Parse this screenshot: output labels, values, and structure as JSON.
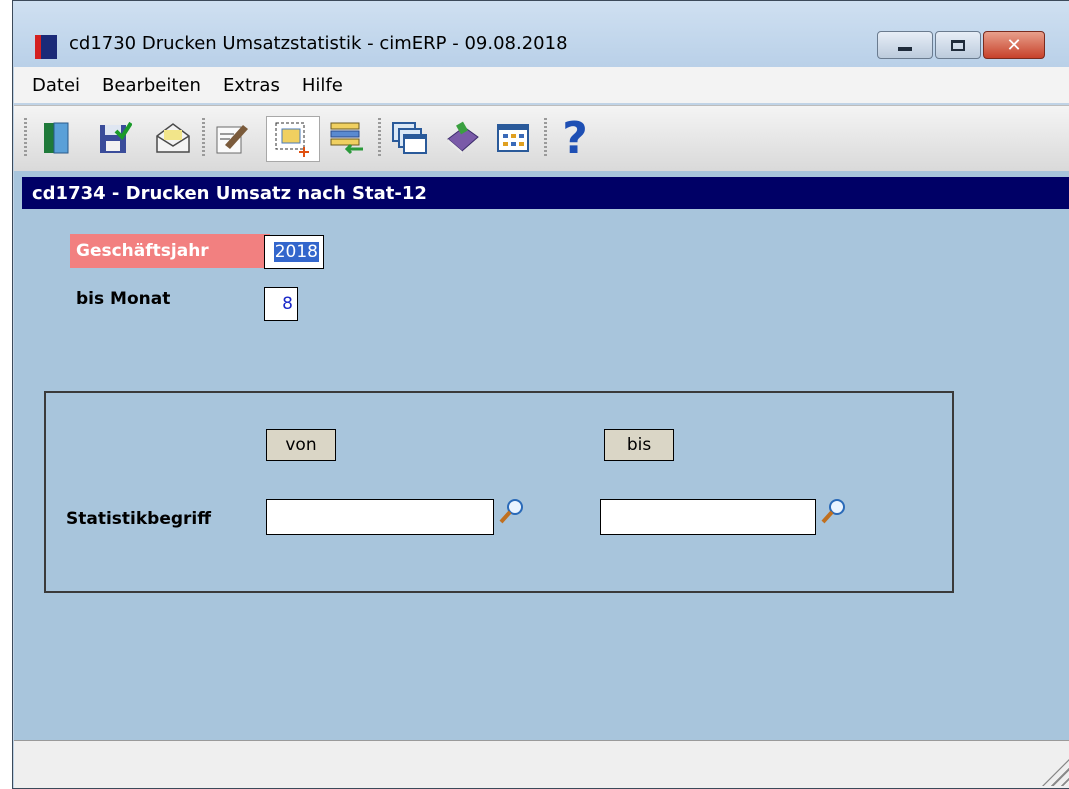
{
  "window": {
    "title": "cd1730 Drucken Umsatzstatistik - cimERP - 09.08.2018",
    "close_label": "✕"
  },
  "menu": [
    "Datei",
    "Bearbeiten",
    "Extras",
    "Hilfe"
  ],
  "toolbar": {
    "icons": [
      "exit-icon",
      "save-icon",
      "mail-icon",
      "edit-icon",
      "new-record-icon",
      "list-transfer-icon",
      "windows-icon",
      "book-icon",
      "grid-icon",
      "help-icon"
    ]
  },
  "section": {
    "title": "cd1734 - Drucken Umsatz nach Stat-12"
  },
  "form": {
    "year_label": "Geschäftsjahr",
    "year_value": "2018",
    "month_label": "bis Monat",
    "month_value": "8"
  },
  "range": {
    "from_label": "von",
    "to_label": "bis",
    "field_label": "Statistikbegriff",
    "from_value": "",
    "to_value": ""
  },
  "colors": {
    "header_bg": "#000066",
    "panel_bg": "#a8c5dc",
    "required_label_bg": "#f28080"
  }
}
